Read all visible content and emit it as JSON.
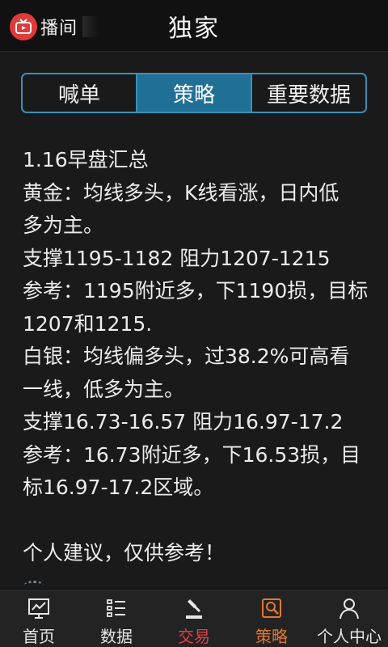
{
  "header": {
    "brand_text": "播间",
    "title": "独家"
  },
  "segments": [
    {
      "label": "喊单",
      "active": false
    },
    {
      "label": "策略",
      "active": true
    },
    {
      "label": "重要数据",
      "active": false
    }
  ],
  "article": {
    "lines": [
      "1.16早盘汇总",
      "黄金：均线多头，K线看涨，日内低",
      "多为主。",
      "支撑1195-1182 阻力1207-1215",
      "参考：1195附近多，下1190损，目标",
      "1207和1215.",
      "白银：均线偏多头，过38.2%可高看",
      "一线，低多为主。",
      "支撑16.73-16.57  阻力16.97-17.2",
      "参考：16.73附近多，下16.53损，目",
      "标16.97-17.2区域。",
      "",
      "个人建议，仅供参考！"
    ]
  },
  "tabbar": {
    "items": [
      {
        "label": "首页",
        "icon": "chart-monitor-icon",
        "color": "#e6e6e6"
      },
      {
        "label": "数据",
        "icon": "list-icon",
        "color": "#e6e6e6"
      },
      {
        "label": "交易",
        "icon": "gavel-icon",
        "color": "#e04040"
      },
      {
        "label": "策略",
        "icon": "strategy-search-icon",
        "color": "#e07a30"
      },
      {
        "label": "个人中心",
        "icon": "person-icon",
        "color": "#e6e6e6"
      }
    ]
  },
  "colors": {
    "accent": "#3a8fb7",
    "active_segment": "#1f6f96",
    "trade_red": "#e04040",
    "strategy_orange": "#e07a30",
    "logo_red": "#e03a3a"
  }
}
